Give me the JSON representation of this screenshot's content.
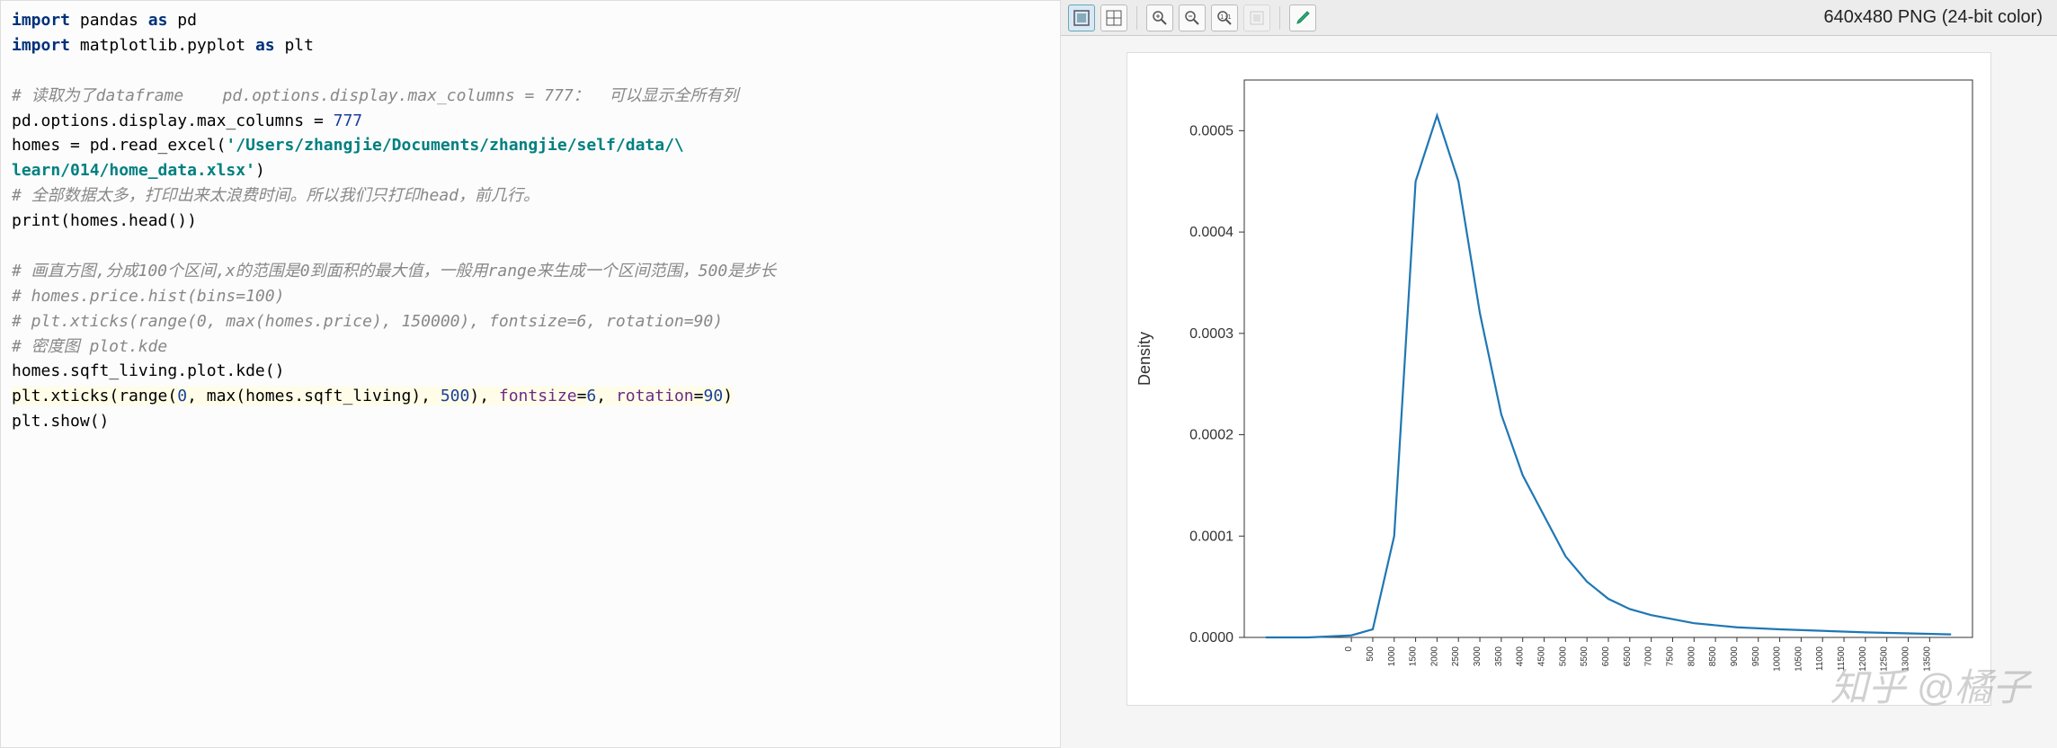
{
  "code": {
    "lines": [
      {
        "t": "kw",
        "txt": "import"
      },
      {
        "t": "",
        "txt": " pandas "
      },
      {
        "t": "kw",
        "txt": "as"
      },
      {
        "t": "",
        "txt": " pd\n"
      },
      {
        "t": "kw",
        "txt": "import"
      },
      {
        "t": "",
        "txt": " matplotlib.pyplot "
      },
      {
        "t": "kw",
        "txt": "as"
      },
      {
        "t": "",
        "txt": " plt\n\n"
      },
      {
        "t": "cm",
        "txt": "# 读取为了dataframe    pd.options.display.max_columns = 777：  可以显示全所有列\n"
      },
      {
        "t": "",
        "txt": "pd.options.display.max_columns = "
      },
      {
        "t": "num",
        "txt": "777"
      },
      {
        "t": "",
        "txt": "\n"
      },
      {
        "t": "",
        "txt": "homes = pd.read_excel("
      },
      {
        "t": "str",
        "txt": "'/Users/zhangjie/Documents/zhangjie/self/data/\\\nlearn/014/home_data.xlsx'"
      },
      {
        "t": "",
        "txt": ")\n"
      },
      {
        "t": "cm",
        "txt": "# 全部数据太多，打印出来太浪费时间。所以我们只打印head，前几行。\n"
      },
      {
        "t": "",
        "txt": "print(homes.head())\n\n"
      },
      {
        "t": "cm",
        "txt": "# 画直方图,分成100个区间,x的范围是0到面积的最大值，一般用range来生成一个区间范围，500是步长\n"
      },
      {
        "t": "cm",
        "txt": "# homes.price.hist(bins=100)\n"
      },
      {
        "t": "cm",
        "txt": "# plt.xticks(range(0, max(homes.price), 150000), fontsize=6, rotation=90)\n"
      },
      {
        "t": "cm",
        "txt": "# 密度图 plot.kde\n"
      },
      {
        "t": "",
        "txt": "homes.sqft_living.plot.kde()\n"
      },
      {
        "t": "hlstart",
        "txt": ""
      },
      {
        "t": "",
        "txt": "plt.xticks(range("
      },
      {
        "t": "num",
        "txt": "0"
      },
      {
        "t": "",
        "txt": ", max(homes.sqft_living), "
      },
      {
        "t": "num",
        "txt": "500"
      },
      {
        "t": "",
        "txt": "), "
      },
      {
        "t": "arg",
        "txt": "fontsize"
      },
      {
        "t": "",
        "txt": "="
      },
      {
        "t": "num",
        "txt": "6"
      },
      {
        "t": "",
        "txt": ", "
      },
      {
        "t": "arg",
        "txt": "rotation"
      },
      {
        "t": "",
        "txt": "="
      },
      {
        "t": "num",
        "txt": "90"
      },
      {
        "t": "",
        "txt": ")\n"
      },
      {
        "t": "hlend",
        "txt": ""
      },
      {
        "t": "",
        "txt": "plt.show()\n"
      }
    ]
  },
  "viewer": {
    "info": "640x480 PNG (24-bit color)"
  },
  "toolbar": {
    "icons": [
      "bounding-box-icon",
      "grid-icon",
      "zoom-in-icon",
      "zoom-out-icon",
      "zoom-reset-icon",
      "fit-icon",
      "eyedropper-icon"
    ]
  },
  "watermark": "知乎 @橘子",
  "chart_data": {
    "type": "line",
    "title": "",
    "xlabel": "",
    "ylabel": "Density",
    "ylim": [
      0,
      0.00055
    ],
    "yticks": [
      0.0,
      0.0001,
      0.0002,
      0.0003,
      0.0004,
      0.0005
    ],
    "ytick_labels": [
      "0.0000",
      "0.0001",
      "0.0002",
      "0.0003",
      "0.0004",
      "0.0005"
    ],
    "xticks": [
      0,
      500,
      1000,
      1500,
      2000,
      2500,
      3000,
      3500,
      4000,
      4500,
      5000,
      5500,
      6000,
      6500,
      7000,
      7500,
      8000,
      8500,
      9000,
      9500,
      10000,
      10500,
      11000,
      11500,
      12000,
      12500,
      13000,
      13500
    ],
    "x": [
      -2000,
      -1000,
      0,
      500,
      1000,
      1500,
      2000,
      2500,
      3000,
      3500,
      4000,
      4500,
      5000,
      5500,
      6000,
      6500,
      7000,
      7500,
      8000,
      9000,
      10000,
      12000,
      14000
    ],
    "values": [
      0,
      0,
      2e-06,
      8e-06,
      0.0001,
      0.00045,
      0.000515,
      0.00045,
      0.00032,
      0.00022,
      0.00016,
      0.00012,
      8e-05,
      5.5e-05,
      3.8e-05,
      2.8e-05,
      2.2e-05,
      1.8e-05,
      1.4e-05,
      1e-05,
      8e-06,
      5e-06,
      3e-06
    ],
    "xlim": [
      -2500,
      14500
    ]
  }
}
